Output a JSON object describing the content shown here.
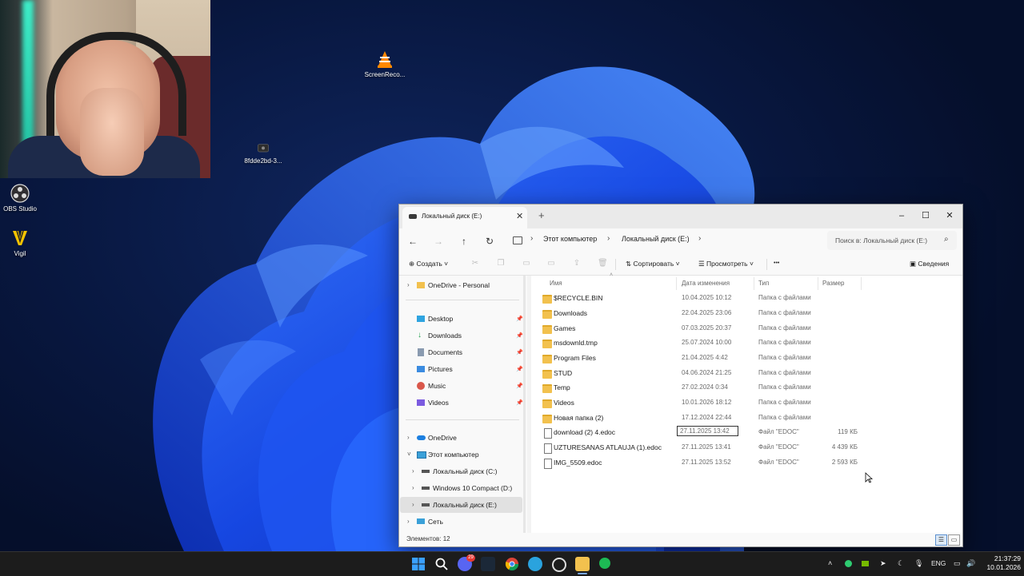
{
  "desktop": {
    "icons": [
      {
        "label": "ScreenReco...",
        "icon": "vlc-icon"
      },
      {
        "label": "8fdde2bd-3...",
        "icon": "app-icon"
      },
      {
        "label": "OBS Studio",
        "icon": "obs-icon"
      },
      {
        "label": "Vigil",
        "icon": "vigil-icon"
      }
    ]
  },
  "window": {
    "tab_title": "Локальный диск (E:)",
    "new_tab": "+",
    "controls": {
      "minimize": "–",
      "maximize": "☐",
      "close": "✕"
    }
  },
  "address": {
    "crumbs": [
      "Этот компьютер",
      "Локальный диск (E:)"
    ],
    "separator": "›",
    "search_placeholder": "Поиск в: Локальный диск (E:)"
  },
  "toolbar": {
    "create": "Создать",
    "sort": "Сортировать",
    "view": "Просмотреть",
    "more": "•••",
    "details": "Сведения"
  },
  "nav": {
    "onedrive_personal": "OneDrive - Personal",
    "quick": [
      {
        "label": "Desktop",
        "icon": "desktop-icon"
      },
      {
        "label": "Downloads",
        "icon": "download-icon"
      },
      {
        "label": "Documents",
        "icon": "documents-icon"
      },
      {
        "label": "Pictures",
        "icon": "pictures-icon"
      },
      {
        "label": "Music",
        "icon": "music-icon"
      },
      {
        "label": "Videos",
        "icon": "videos-icon"
      }
    ],
    "onedrive": "OneDrive",
    "this_pc": "Этот компьютер",
    "drives": [
      "Локальный диск (C:)",
      "Windows 10 Compact  (D:)",
      "Локальный диск (E:)"
    ],
    "network": "Сеть"
  },
  "columns": {
    "name": "Имя",
    "date": "Дата изменения",
    "type": "Тип",
    "size": "Размер"
  },
  "files": [
    {
      "name": "$RECYCLE.BIN",
      "date": "10.04.2025 10:12",
      "type": "Папка с файлами",
      "size": "",
      "kind": "folder"
    },
    {
      "name": "Downloads",
      "date": "22.04.2025 23:06",
      "type": "Папка с файлами",
      "size": "",
      "kind": "folder"
    },
    {
      "name": "Games",
      "date": "07.03.2025 20:37",
      "type": "Папка с файлами",
      "size": "",
      "kind": "folder"
    },
    {
      "name": "msdownld.tmp",
      "date": "25.07.2024 10:00",
      "type": "Папка с файлами",
      "size": "",
      "kind": "folder"
    },
    {
      "name": "Program Files",
      "date": "21.04.2025 4:42",
      "type": "Папка с файлами",
      "size": "",
      "kind": "folder"
    },
    {
      "name": "STUD",
      "date": "04.06.2024 21:25",
      "type": "Папка с файлами",
      "size": "",
      "kind": "folder"
    },
    {
      "name": "Temp",
      "date": "27.02.2024 0:34",
      "type": "Папка с файлами",
      "size": "",
      "kind": "folder"
    },
    {
      "name": "Videos",
      "date": "10.01.2026 18:12",
      "type": "Папка с файлами",
      "size": "",
      "kind": "folder"
    },
    {
      "name": "Новая папка (2)",
      "date": "17.12.2024 22:44",
      "type": "Папка с файлами",
      "size": "",
      "kind": "folder"
    },
    {
      "name": "download (2) 4.edoc",
      "date": "27.11.2025 13:42",
      "type": "Файл \"EDOC\"",
      "size": "119 КБ",
      "kind": "file"
    },
    {
      "name": "UZTURESANAS ATLAUJA (1).edoc",
      "date": "27.11.2025 13:41",
      "type": "Файл \"EDOC\"",
      "size": "4 439 КБ",
      "kind": "file"
    },
    {
      "name": "IMG_5509.edoc",
      "date": "27.11.2025 13:52",
      "type": "Файл \"EDOC\"",
      "size": "2 593 КБ",
      "kind": "file"
    }
  ],
  "status": {
    "items": "Элементов: 12"
  },
  "taskbar": {
    "discord_badge": "29",
    "lang": "ENG",
    "time": "21:37:29",
    "date": "10.01.2026"
  }
}
